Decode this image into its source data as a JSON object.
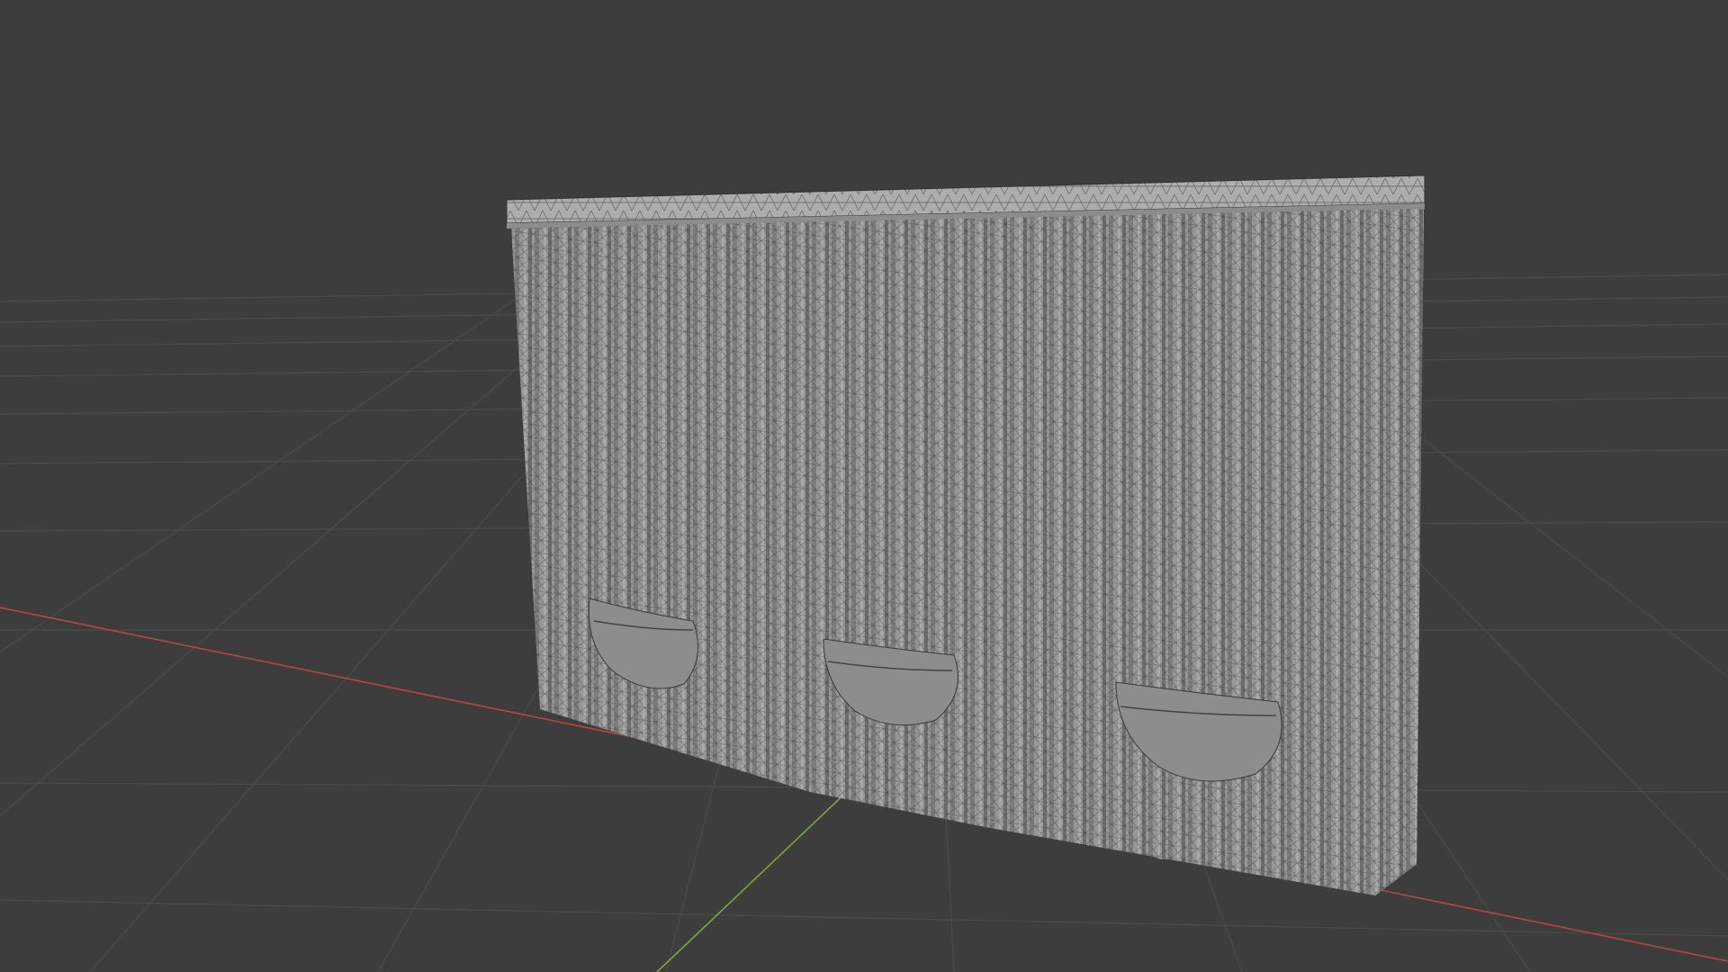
{
  "viewport": {
    "background": "#3d3d3d",
    "grid_color": "#4a4a4a",
    "x_axis_color": "#b5474b",
    "y_axis_color": "#7fa63a",
    "origin_marker_color": "#f2d33c"
  },
  "scene": {
    "object": "curtain-model",
    "display_mode": "solid-with-wireframe",
    "panel_count": 3,
    "tie_back_count": 3,
    "mesh_color": "#9a9a9a",
    "wire_color": "#2e2e2e",
    "rail_color": "#a8a8a8"
  }
}
